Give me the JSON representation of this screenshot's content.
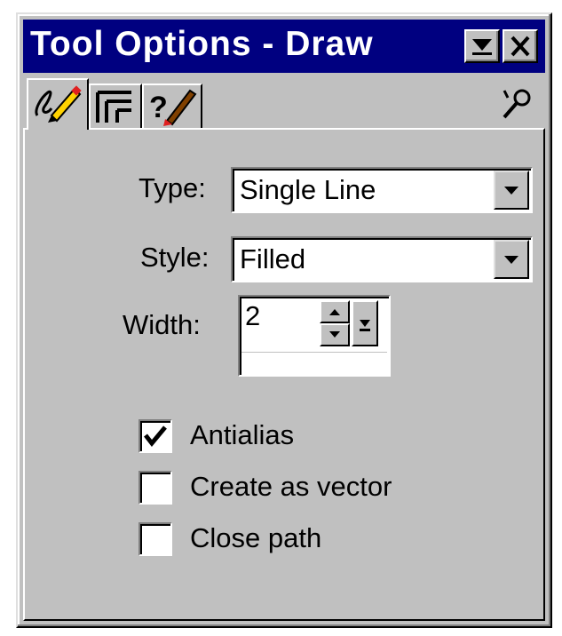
{
  "window": {
    "title": "Tool Options - Draw"
  },
  "titlebar_buttons": {
    "menu_icon": "down-triangle-icon",
    "close_icon": "close-icon"
  },
  "tabs": [
    {
      "icon": "pencil-icon",
      "selected": true
    },
    {
      "icon": "tab-layout-icon",
      "selected": false
    },
    {
      "icon": "help-brush-icon",
      "selected": false
    }
  ],
  "tools_icon": "wrench-icon",
  "form": {
    "type_label": "Type:",
    "type_value": "Single Line",
    "style_label": "Style:",
    "style_value": "Filled",
    "width_label": "Width:",
    "width_value": "2"
  },
  "options": [
    {
      "label": "Antialias",
      "checked": true
    },
    {
      "label": "Create as vector",
      "checked": false
    },
    {
      "label": "Close path",
      "checked": false
    }
  ],
  "colors": {
    "titlebar": "#000080",
    "face": "#c0c0c0",
    "field": "#ffffff"
  }
}
